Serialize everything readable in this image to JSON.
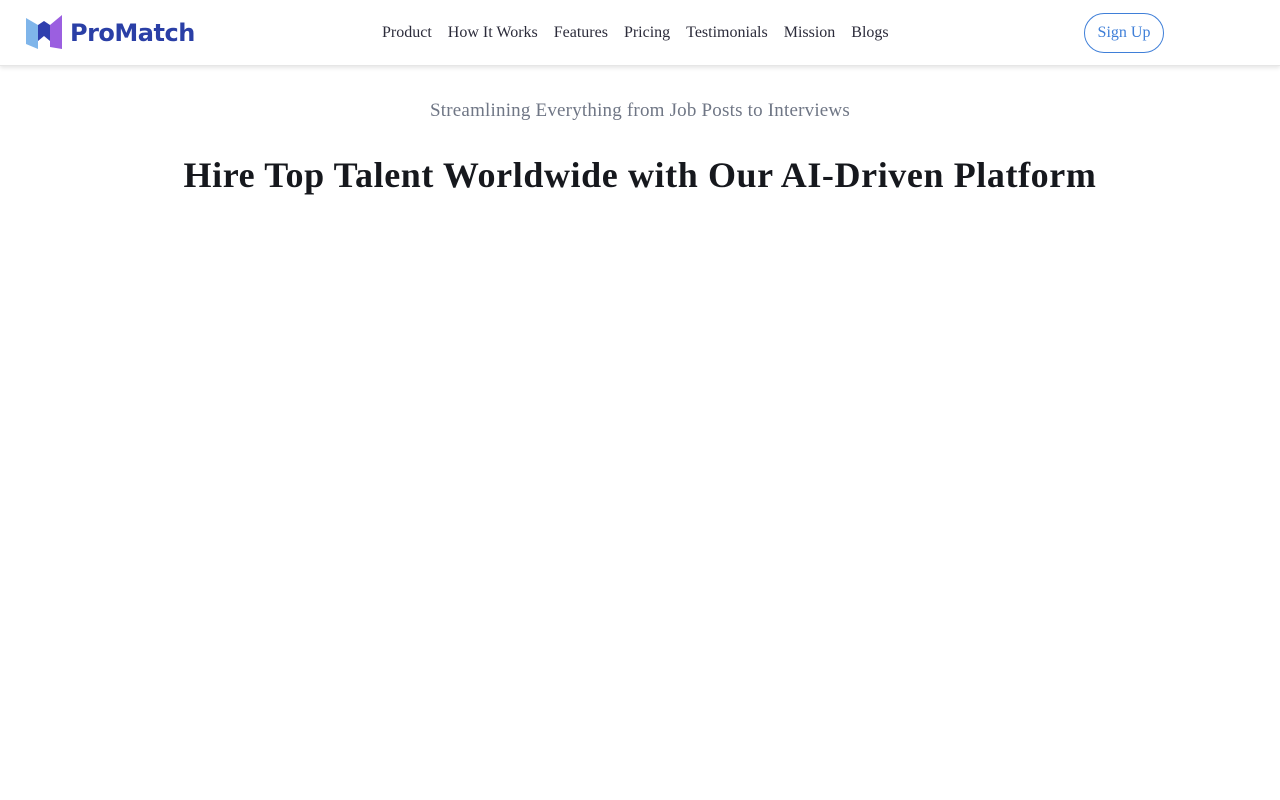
{
  "brand": {
    "name": "ProMatch",
    "colors": {
      "text": "#2a3fa6",
      "mark_left": "#7fb5ea",
      "mark_center": "#2f3fae",
      "mark_right": "#9b5fe0"
    }
  },
  "nav": {
    "items": [
      {
        "label": "Product"
      },
      {
        "label": "How It Works"
      },
      {
        "label": "Features"
      },
      {
        "label": "Pricing"
      },
      {
        "label": "Testimonials"
      },
      {
        "label": "Mission"
      },
      {
        "label": "Blogs"
      }
    ],
    "signup_label": "Sign Up",
    "accent_color": "#3f7fd8"
  },
  "hero": {
    "subtitle": "Streamlining Everything from Job Posts to Interviews",
    "title": "Hire Top Talent Worldwide with Our AI-Driven Platform"
  }
}
